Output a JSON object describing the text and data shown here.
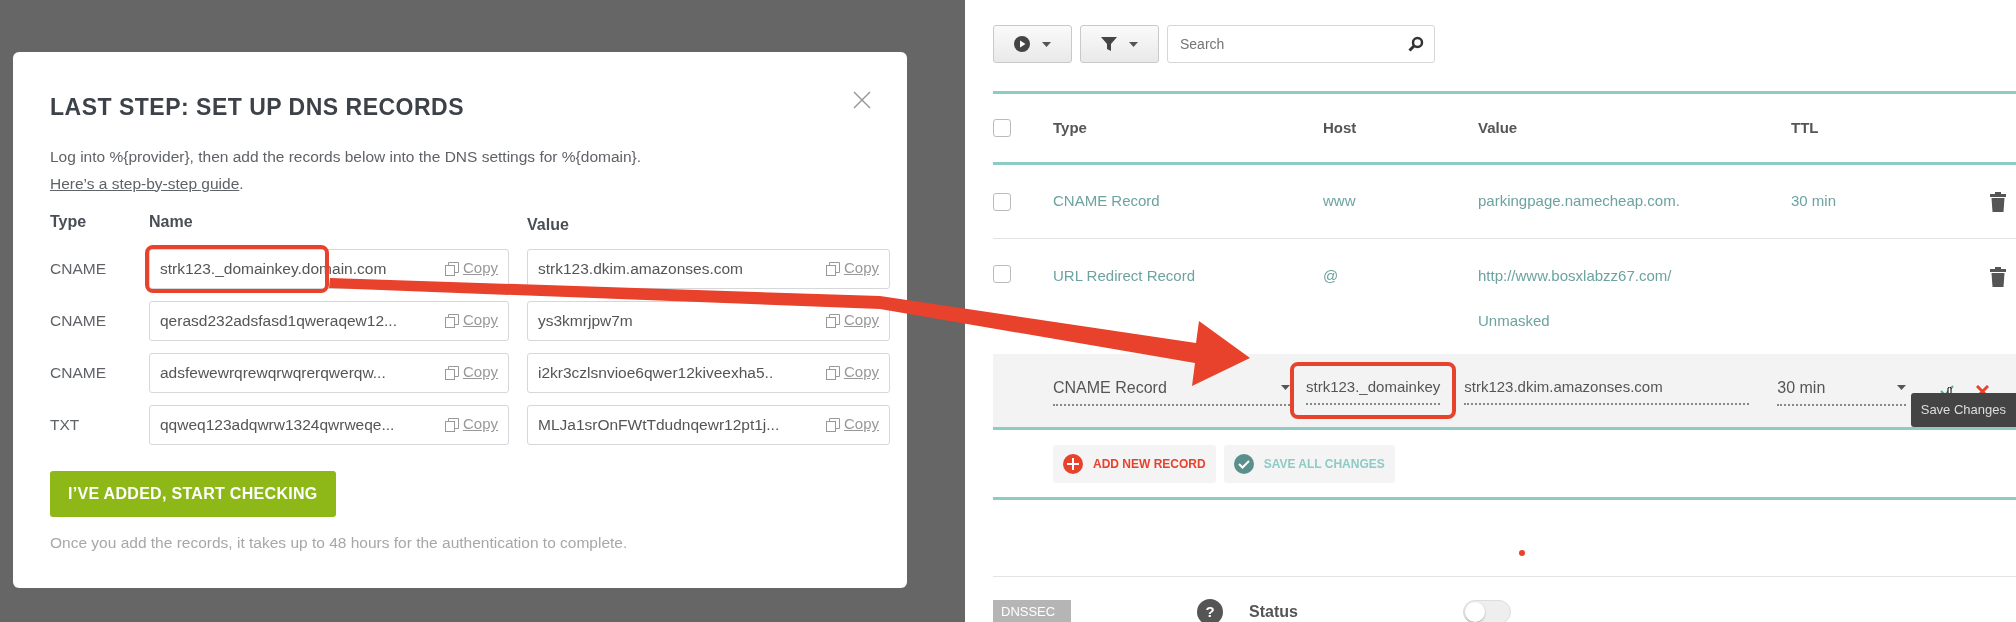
{
  "modal": {
    "title": "LAST STEP: SET UP DNS RECORDS",
    "intro": "Log into %{provider}, then add the records below into the DNS settings for %{domain}. ",
    "guide_link": "Here’s a step-by-step guide",
    "intro_end": ".",
    "columns": [
      "Type",
      "Name",
      "Value"
    ],
    "records": [
      {
        "type": "CNAME",
        "name": "strk123._domainkey.domain.com",
        "value": "strk123.dkim.amazonses.com",
        "copy_name": "Copy",
        "copy_value": "Copy",
        "highlighted": true
      },
      {
        "type": "CNAME",
        "name": "qerasd232adsfasd1qweraqew12...",
        "value": "ys3kmrjpw7m",
        "copy_name": "Copy",
        "copy_value": "Copy",
        "highlighted": false
      },
      {
        "type": "CNAME",
        "name": "adsfewewrqrewqrwqrerqwerqw...",
        "value": "i2kr3czlsnvioe6qwer12kiveexha5..",
        "copy_name": "Copy",
        "copy_value": "Copy",
        "highlighted": false
      },
      {
        "type": "TXT",
        "name": "qqweq123adqwrw1324qwrweqe...",
        "value": "MLJa1srOnFWtTdudnqewr12pt1j...",
        "copy_name": "Copy",
        "copy_value": "Copy",
        "highlighted": false
      }
    ],
    "button": "I’VE ADDED, START CHECKING",
    "note": "Once you add the records, it takes up to 48 hours for the authentication to complete."
  },
  "panel": {
    "search": {
      "placeholder": "Search"
    },
    "columns": [
      "Type",
      "Host",
      "Value",
      "TTL"
    ],
    "header_checked": false,
    "rows": [
      {
        "type": "CNAME Record",
        "host": "www",
        "value": "parkingpage.namecheap.com.",
        "ttl": "30 min",
        "checked": false
      },
      {
        "type": "URL Redirect Record",
        "host": "@",
        "value": "http://www.bosxlabzz67.com/",
        "value_note": "Unmasked",
        "checked": false
      }
    ],
    "edit_row": {
      "type": "CNAME Record",
      "host": "strk123._domainkey",
      "value": "strk123.dkim.amazonses.com",
      "ttl": "30 min",
      "tooltip": "Save Changes",
      "host_highlighted": true
    },
    "actions": [
      {
        "label": "ADD NEW RECORD",
        "kind": "add"
      },
      {
        "label": "SAVE ALL CHANGES",
        "kind": "save"
      }
    ],
    "dnssec": {
      "tag": "DNSSEC",
      "help": "?",
      "label": "Status",
      "on": false
    }
  }
}
